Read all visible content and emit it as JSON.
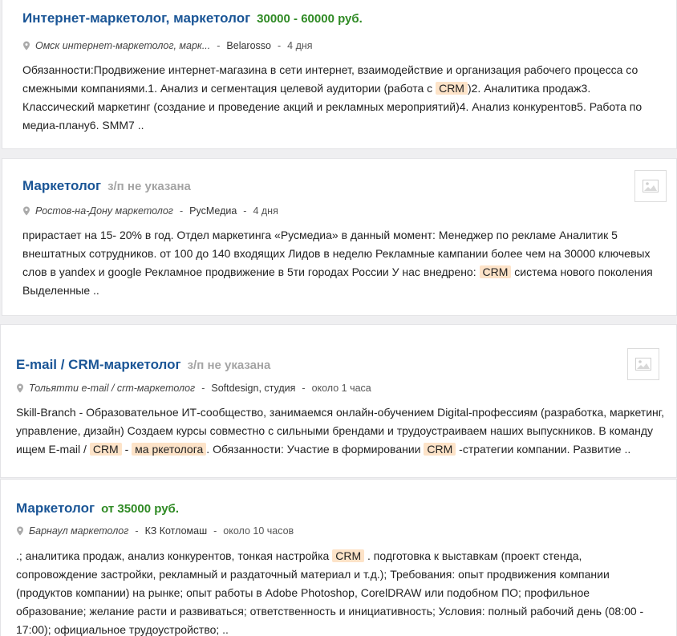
{
  "listings": [
    {
      "title": "Интернет-маркетолог, маркетолог",
      "salary": "30000 - 60000 руб.",
      "location": "Омск интернет-маркетолог, марк...",
      "company": "Belarosso",
      "time": "4 дня",
      "desc": [
        "Обязанности:Продвижение интернет-магазина в сети интернет, взаимодействие и организация рабочего процесса со смежными компаниями.1. Анализ и сегментация целевой аудитории (работа с ",
        "CRM",
        ")2. Аналитика продаж3. Классический маркетинг (создание и проведение акций и рекламных мероприятий)4. Анализ конкурентов5. Работа по медиа-плану6. SMM7 .."
      ]
    },
    {
      "title": "Маркетолог",
      "salary": "з/п не указана",
      "location": "Ростов-на-Дону маркетолог",
      "company": "РусМедиа",
      "time": "4 дня",
      "desc": [
        "прирастает на 15- 20% в год. Отдел маркетинга «Русмедиа» в данный момент: Менеджер по рекламе Аналитик 5 внештатных сотрудников. от 100 до 140 входящих Лидов в неделю Рекламные кампании более чем на 30000 ключевых слов в yandex и google Рекламное продвижение в 5ти городах России У нас внедрено: ",
        "CRM",
        " система нового поколения Выделенные .."
      ]
    },
    {
      "title": "E-mail / CRM-маркетолог",
      "salary": "з/п не указана",
      "location": "Тольятти e-mail / crm-маркетолог",
      "company": "Softdesign, студия",
      "time": "около 1 часа",
      "desc": [
        "Skill-Branch - Образовательное ИТ-сообщество, занимаемся онлайн-обучением Digital-профессиям (разработка, маркетинг, управление, дизайн) Создаем курсы совместно с сильными брендами и трудоустраиваем наших выпускников. В команду ищем E-mail / ",
        "CRM",
        " - ",
        "ма ркетолога",
        ". Обязанности: Участие в формировании ",
        "CRM",
        " -стратегии компании. Развитие .."
      ]
    },
    {
      "title": "Маркетолог",
      "salary": "от 35000 руб.",
      "location": "Барнаул маркетолог",
      "company": "КЗ Котломаш",
      "time": "около 10 часов",
      "desc": [
        ".; аналитика продаж, анализ конкурентов, тонкая настройка ",
        "CRM",
        " . подготовка к выставкам (проект стенда, сопровождение застройки, рекламный и раздаточный материал и т.д.); Требования: опыт продвижения компании (продуктов компании) на рынке; опыт работы в Adobe Photoshop, CorelDRAW или подобном ПО; профильное образование; желание расти и развиваться; ответственность и инициативность; Условия: полный рабочий день (08:00 - 17:00); официальное трудоустройство; .."
      ]
    }
  ],
  "thumb_icon": "image-placeholder-icon",
  "colors": {
    "title": "#1a5596",
    "salary_green": "#2f8a24",
    "salary_gray": "#a4a4a4",
    "highlight": "#fde3c8"
  }
}
